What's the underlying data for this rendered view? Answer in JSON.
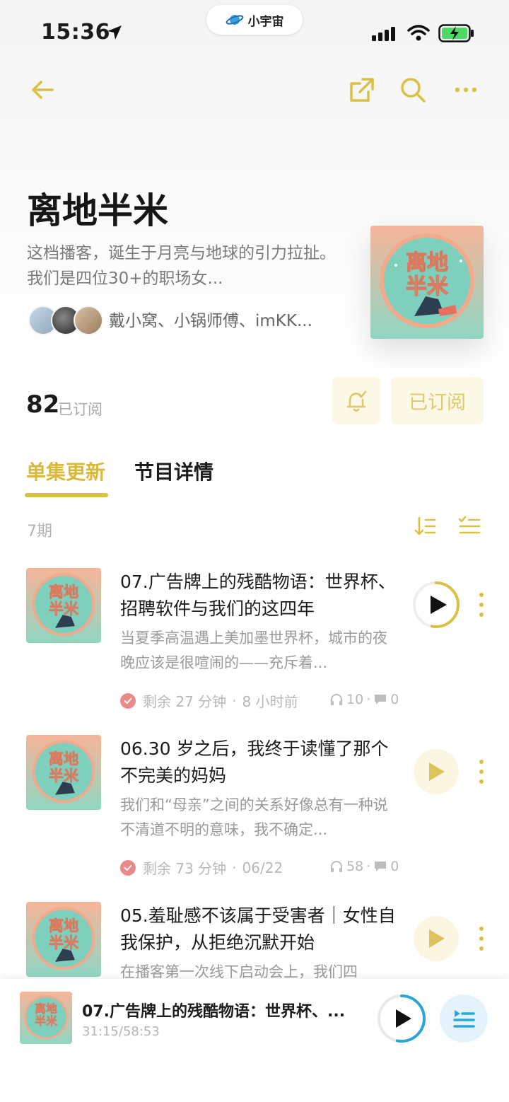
{
  "status_bar": {
    "time": "15:36",
    "app_pill": "小宇宙"
  },
  "podcast": {
    "title": "离地半米",
    "description": "这档播客，诞生于月亮与地球的引力拉扯。 我们是四位30+的职场女...",
    "hosts": "戴小窝、小锅师傅、imKK...",
    "cover_text": "离地半米",
    "subscriber_count": "82",
    "subscriber_label": "已订阅",
    "subscribed_button": "已订阅"
  },
  "tabs": [
    {
      "label": "单集更新",
      "active": true
    },
    {
      "label": "节目详情",
      "active": false
    }
  ],
  "episode_count_label": "7期",
  "episodes": [
    {
      "title": "07.广告牌上的残酷物语：世界杯、招聘软件与我们的这四年",
      "description": "当夏季高温遇上美加墨世界杯，城市的夜晚应该是很喧闹的——充斥着...",
      "remaining": "剩余 27 分钟",
      "date": "8 小时前",
      "listens": "10",
      "comments": "0",
      "playing": true,
      "progress": 0.53
    },
    {
      "title": "06.30 岁之后，我终于读懂了那个不完美的妈妈",
      "description": "我们和“母亲”之间的关系好像总有一种说不清道不明的意味，我不确定...",
      "remaining": "剩余 73 分钟",
      "date": "06/22",
      "listens": "58",
      "comments": "0",
      "playing": false
    },
    {
      "title": "05.羞耻感不该属于受害者｜女性自我保护，从拒绝沉默开始",
      "description": "在播客第一次线下启动会上，我们四",
      "playing": false
    }
  ],
  "mini_player": {
    "title": "07.广告牌上的残酷物语：世界杯、...",
    "time": "31:15/58:53",
    "progress": 0.53
  },
  "colors": {
    "accent": "#d9c143",
    "accent_soft": "#fbf8e6",
    "check_red": "#e88a8a",
    "player_blue": "#2aa6d8"
  }
}
